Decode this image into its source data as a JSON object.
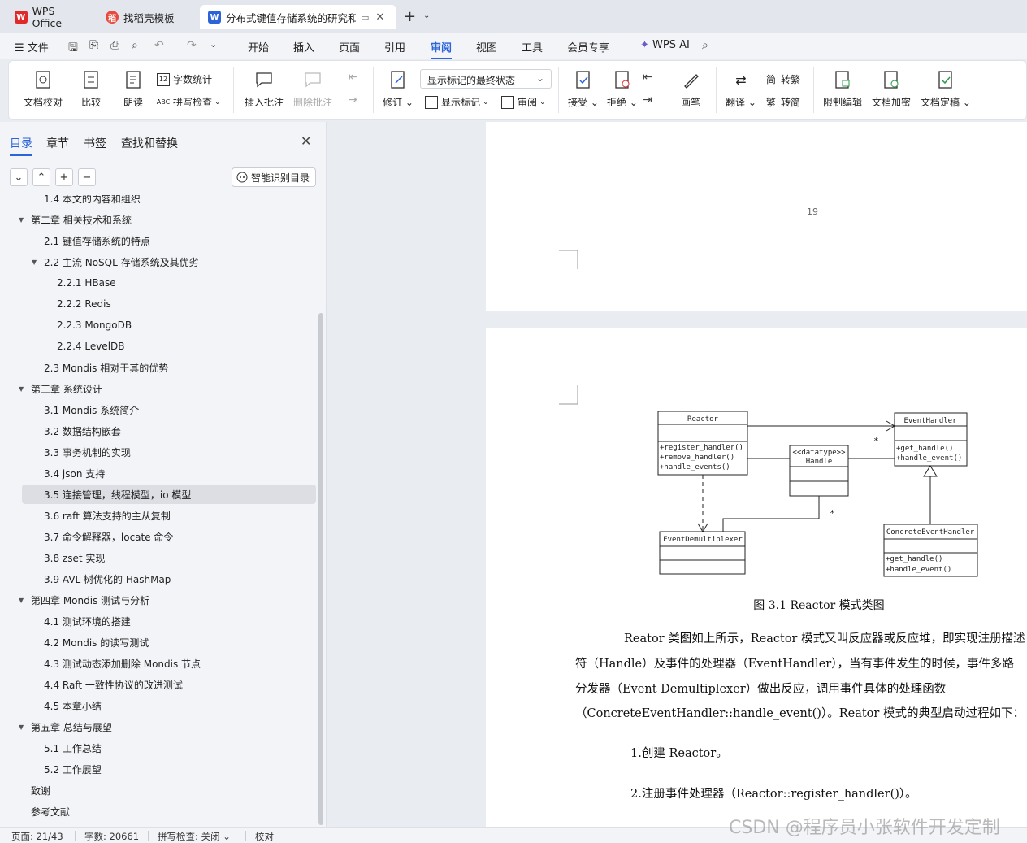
{
  "tabs": [
    {
      "label": "WPS Office",
      "icon": "wps-logo-icon"
    },
    {
      "label": "找稻壳模板",
      "icon": "docer-icon"
    },
    {
      "label": "分布式键值存储系统的研究和",
      "icon": "word-doc-icon",
      "active": true
    }
  ],
  "menubar": {
    "file": "文件",
    "items": [
      "开始",
      "插入",
      "页面",
      "引用",
      "审阅",
      "视图",
      "工具",
      "会员专享"
    ],
    "active": "审阅",
    "ai": "WPS AI"
  },
  "ribbon": {
    "doc_proof": "文档校对",
    "compare": "比较",
    "read_aloud": "朗读",
    "word_count": "字数统计",
    "spell_check": "拼写检查",
    "insert_comment": "插入批注",
    "delete_comment": "删除批注",
    "revise": "修订",
    "markup_state": "显示标记的最终状态",
    "show_markup": "显示标记",
    "review": "审阅",
    "accept": "接受",
    "reject": "拒绝",
    "pen": "画笔",
    "translate": "翻译",
    "to_traditional": "转繁",
    "to_simplified": "转简",
    "restrict_edit": "限制编辑",
    "encrypt": "文档加密",
    "finalize": "文档定稿"
  },
  "panel": {
    "tabs": [
      "目录",
      "章节",
      "书签",
      "查找和替换"
    ],
    "smart_toc": "智能识别目录",
    "toc": [
      {
        "text": "1.4  本文的内容和组织",
        "level": 2
      },
      {
        "text": "第二章  相关技术和系统",
        "level": 1,
        "expanded": true
      },
      {
        "text": "2.1  键值存储系统的特点",
        "level": 2
      },
      {
        "text": "2.2  主流 NoSQL 存储系统及其优劣",
        "level": 2,
        "expanded": true
      },
      {
        "text": "2.2.1 HBase",
        "level": 3
      },
      {
        "text": "2.2.2 Redis",
        "level": 3
      },
      {
        "text": "2.2.3 MongoDB",
        "level": 3
      },
      {
        "text": "2.2.4 LevelDB",
        "level": 3
      },
      {
        "text": "2.3 Mondis 相对于其的优势",
        "level": 2
      },
      {
        "text": "第三章  系统设计",
        "level": 1,
        "expanded": true
      },
      {
        "text": "3.1 Mondis 系统简介",
        "level": 2
      },
      {
        "text": "3.2  数据结构嵌套",
        "level": 2
      },
      {
        "text": "3.3  事务机制的实现",
        "level": 2
      },
      {
        "text": "3.4 json 支持",
        "level": 2
      },
      {
        "text": "3.5  连接管理，线程模型，io 模型",
        "level": 2,
        "selected": true
      },
      {
        "text": "3.6 raft 算法支持的主从复制",
        "level": 2
      },
      {
        "text": "3.7  命令解释器，locate 命令",
        "level": 2
      },
      {
        "text": "3.8 zset 实现",
        "level": 2
      },
      {
        "text": "3.9 AVL 树优化的 HashMap",
        "level": 2
      },
      {
        "text": "第四章  Mondis 测试与分析",
        "level": 1,
        "expanded": true
      },
      {
        "text": "4.1  测试环境的搭建",
        "level": 2
      },
      {
        "text": "4.2 Mondis 的读写测试",
        "level": 2
      },
      {
        "text": "4.3  测试动态添加删除 Mondis 节点",
        "level": 2
      },
      {
        "text": "4.4 Raft 一致性协议的改进测试",
        "level": 2
      },
      {
        "text": "4.5  本章小结",
        "level": 2
      },
      {
        "text": "第五章  总结与展望",
        "level": 1,
        "expanded": true
      },
      {
        "text": "5.1  工作总结",
        "level": 2
      },
      {
        "text": "5.2  工作展望",
        "level": 2
      },
      {
        "text": "致谢",
        "level": 1
      },
      {
        "text": "参考文献",
        "level": 1
      }
    ]
  },
  "document": {
    "page_number": "19",
    "uml": {
      "reactor": {
        "name": "Reactor",
        "ops": [
          "+register_handler()",
          "+remove_handler()",
          "+handle_events()"
        ]
      },
      "event_handler": {
        "name": "EventHandler",
        "ops": [
          "+get_handle()",
          "+handle_event()"
        ]
      },
      "handle": {
        "stereotype": "<<datatype>>",
        "name": "Handle"
      },
      "demux": {
        "name": "EventDemultiplexer"
      },
      "concrete": {
        "name": "ConcreteEventHandler",
        "ops": [
          "+get_handle()",
          "+handle_event()"
        ]
      },
      "multiplicity": "*"
    },
    "caption": "图  3.1 Reactor 模式类图",
    "paragraphs": [
      "Reator 类图如上所示，Reactor 模式又叫反应器或反应堆，即实现注册描述",
      "符（Handle）及事件的处理器（EventHandler），当有事件发生的时候，事件多路",
      "分发器（Event Demultiplexer）做出反应，调用事件具体的处理函数",
      "（ConcreteEventHandler::handle_event()）。Reator 模式的典型启动过程如下："
    ],
    "steps": [
      "1.创建 Reactor。",
      "2.注册事件处理器（Reactor::register_handler()）。"
    ]
  },
  "status": {
    "page": "页面: 21/43",
    "words": "字数: 20661",
    "spell": "拼写检查: 关闭",
    "proof": "校对"
  },
  "watermark": "CSDN @程序员小张软件开发定制"
}
